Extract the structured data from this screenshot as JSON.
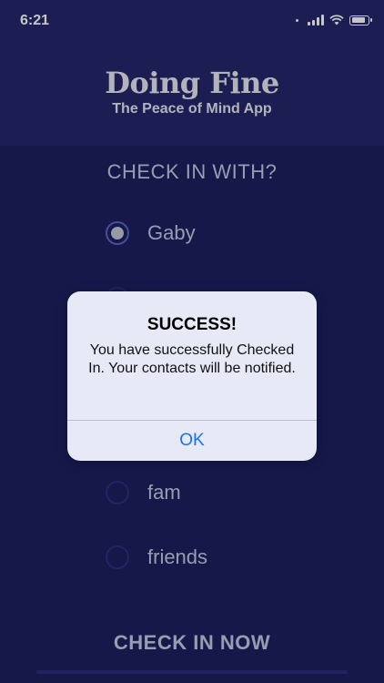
{
  "status_bar": {
    "time": "6:21"
  },
  "header": {
    "title": "Doing Fine",
    "subtitle": "The Peace of Mind App"
  },
  "question": "CHECK IN WITH?",
  "options": [
    {
      "label": "Gaby",
      "selected": true
    },
    {
      "label": "fam",
      "selected": false
    },
    {
      "label": "friends",
      "selected": false
    }
  ],
  "cta_label": "CHECK IN NOW",
  "alert": {
    "title": "SUCCESS!",
    "message": "You have successfully Checked In. Your contacts will be notified.",
    "button": "OK"
  },
  "colors": {
    "background": "#1c1f5e",
    "header": "#23266b",
    "alert_background": "#e7e9f7",
    "link_blue": "#1a73e8"
  }
}
